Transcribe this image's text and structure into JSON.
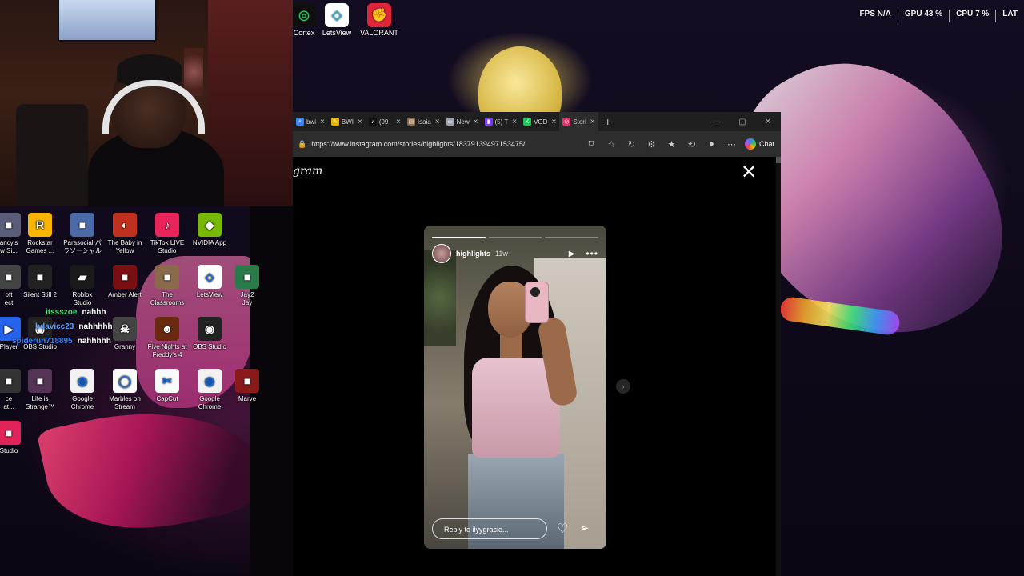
{
  "overlay": {
    "fps_label": "FPS",
    "fps_value": "N/A",
    "gpu_label": "GPU",
    "gpu_value": "43 %",
    "cpu_label": "CPU",
    "cpu_value": "7 %",
    "lat_label": "LAT"
  },
  "top_icons": [
    {
      "label": "Cortex",
      "icon": "cortex-icon",
      "color": "#22c55e"
    },
    {
      "label": "LetsView",
      "icon": "letsview-icon",
      "color": "#ffffff"
    },
    {
      "label": "VALORANT",
      "icon": "valorant-icon",
      "color": "#e0243a"
    }
  ],
  "desktop_icons": [
    {
      "label": "ancy's\nw Si...",
      "icon": "game-icon",
      "color": "#5b5b7a"
    },
    {
      "label": "Rockstar\nGames ...",
      "icon": "rockstar-icon",
      "color": "#f7b500",
      "glyph": "R"
    },
    {
      "label": "Parasocial パ\nラソーシャル",
      "icon": "game-icon",
      "color": "#4a6aa8"
    },
    {
      "label": "The Baby in\nYellow",
      "icon": "baby-icon",
      "color": "#c0301e"
    },
    {
      "label": "TikTok LIVE\nStudio",
      "icon": "tiktok-icon",
      "color": "#e8245a"
    },
    {
      "label": "NVIDIA App",
      "icon": "nvidia-icon",
      "color": "#76b900"
    },
    {
      "label": "oft\nect",
      "icon": "app-icon",
      "color": "#444"
    },
    {
      "label": "Silent Still 2",
      "icon": "game-icon",
      "color": "#222"
    },
    {
      "label": "Roblox\nStudio",
      "icon": "roblox-icon",
      "color": "#1a1a1a"
    },
    {
      "label": "Amber Alert",
      "icon": "game-icon",
      "color": "#7a0f12"
    },
    {
      "label": "The\nClassrooms",
      "icon": "game-icon",
      "color": "#8a6a4a"
    },
    {
      "label": "LetsView",
      "icon": "letsview-icon",
      "color": "#ffffff"
    },
    {
      "label": "Jay2\nJay",
      "icon": "app-icon",
      "color": "#2a7a4a"
    },
    {
      "label": "Player",
      "icon": "player-icon",
      "color": "#2563eb"
    },
    {
      "label": "OBS Studio",
      "icon": "obs-icon",
      "color": "#222"
    },
    {
      "label": "Granny",
      "icon": "granny-icon",
      "color": "#444"
    },
    {
      "label": "Five Nights at\nFreddy's 4",
      "icon": "fnaf-icon",
      "color": "#6a2a10"
    },
    {
      "label": "OBS Studio",
      "icon": "obs-icon",
      "color": "#222"
    },
    {
      "label": "ce\nat...",
      "icon": "app-icon",
      "color": "#333"
    },
    {
      "label": "Life is\nStrange™",
      "icon": "game-icon",
      "color": "#553355"
    },
    {
      "label": "Google\nChrome",
      "icon": "chrome-icon",
      "color": "#f2f2f2"
    },
    {
      "label": "Marbles on\nStream",
      "icon": "marbles-icon",
      "color": "#fafafa"
    },
    {
      "label": "CapCut",
      "icon": "capcut-icon",
      "color": "#fafafa"
    },
    {
      "label": "Google\nChrome",
      "icon": "chrome-icon",
      "color": "#f2f2f2"
    },
    {
      "label": "Marve",
      "icon": "game-icon",
      "color": "#8a1a1a"
    },
    {
      "label": "Studio",
      "icon": "app-icon",
      "color": "#e0245a"
    }
  ],
  "chat": [
    {
      "user": "itssszoe",
      "message": "nahhh",
      "color": "#4ade80"
    },
    {
      "user": "bdavicc23",
      "message": "nahhhhh",
      "color": "#60a5fa"
    },
    {
      "user": "spiderun718895",
      "message": "nahhhhh",
      "color": "#3b82f6"
    }
  ],
  "browser": {
    "tabs": [
      {
        "label": "bwi",
        "icon": "search-icon",
        "color": "#3b82f6"
      },
      {
        "label": "BWI",
        "icon": "bwi-icon",
        "color": "#eab308"
      },
      {
        "label": "(99+",
        "icon": "tiktok-icon",
        "color": "#111111"
      },
      {
        "label": "Isaia",
        "icon": "page-icon",
        "color": "#8a6a4a"
      },
      {
        "label": "New",
        "icon": "newtab-icon",
        "color": "#9ca3af"
      },
      {
        "label": "(5) T",
        "icon": "twitch-icon",
        "color": "#7c3aed"
      },
      {
        "label": "VOD",
        "icon": "kick-icon",
        "color": "#22c55e"
      },
      {
        "label": "Stori",
        "icon": "instagram-icon",
        "color": "#e1306c",
        "active": true
      }
    ],
    "url": "https://www.instagram.com/stories/highlights/18379139497153475/",
    "chat_label": "Chat",
    "ig_logo": "gram"
  },
  "story": {
    "username": "highlights",
    "time": "11w",
    "reply_placeholder": "Reply to ilyygracie...",
    "progress": [
      1.0,
      0.0,
      0.0
    ]
  }
}
